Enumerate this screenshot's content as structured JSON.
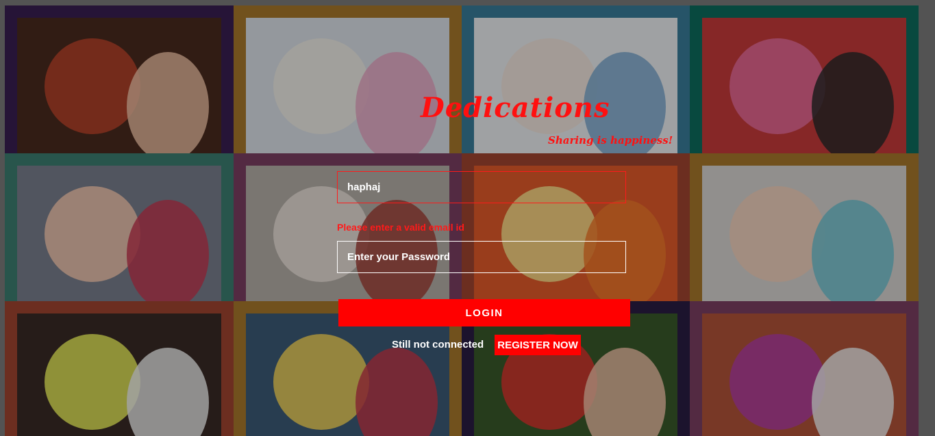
{
  "brand": {
    "title": "Dedications",
    "tagline": "Sharing is happiness!"
  },
  "login_form": {
    "email_value": "haphaj",
    "email_error": "Please enter a valid email id",
    "password_placeholder": "Enter your Password",
    "login_label": "LOGIN",
    "still_not_connected": "Still not connected",
    "register_label": "REGISTER NOW"
  },
  "colors": {
    "accent": "#ff0000",
    "page_background": "#7d7d7d"
  },
  "gallery": [
    {
      "frame": "#3a1f52",
      "photo_a": "#b9422a",
      "photo_b": "#f0c2a4",
      "bg": "#4a2a1e"
    },
    {
      "frame": "#a9792c",
      "photo_a": "#f2efe9",
      "photo_b": "#e9a8c6",
      "bg": "#dde3ea"
    },
    {
      "frame": "#3a7e9b",
      "photo_a": "#f4e6de",
      "photo_b": "#7aa9cf",
      "bg": "#eef1f3"
    },
    {
      "frame": "#0c6e5e",
      "photo_a": "#e96b9a",
      "photo_b": "#2a2a2a",
      "bg": "#c83b3b"
    },
    {
      "frame": "#3c7f72",
      "photo_a": "#f3c8b0",
      "photo_b": "#c43a52",
      "bg": "#7a7f8e"
    },
    {
      "frame": "#7d3f63",
      "photo_a": "#ece3dc",
      "photo_b": "#a3423a",
      "bg": "#b7b0a9"
    },
    {
      "frame": "#a14530",
      "photo_a": "#fce08a",
      "photo_b": "#f37a2c",
      "bg": "#e45b2b"
    },
    {
      "frame": "#a9792c",
      "photo_a": "#f4d3bd",
      "photo_b": "#6fc3d3",
      "bg": "#d9d5d2"
    },
    {
      "frame": "#a14530",
      "photo_a": "#e8ec5a",
      "photo_b": "#f2f2f2",
      "bg": "#3a2b26"
    },
    {
      "frame": "#a9792c",
      "photo_a": "#f1d25a",
      "photo_b": "#c4394a",
      "bg": "#3d5b78"
    },
    {
      "frame": "#2a1d44",
      "photo_a": "#d8352f",
      "photo_b": "#f3c3a8",
      "bg": "#3a5a2a"
    },
    {
      "frame": "#7d3f63",
      "photo_a": "#b33fa0",
      "photo_b": "#f2f2f2",
      "bg": "#b3543a"
    }
  ]
}
